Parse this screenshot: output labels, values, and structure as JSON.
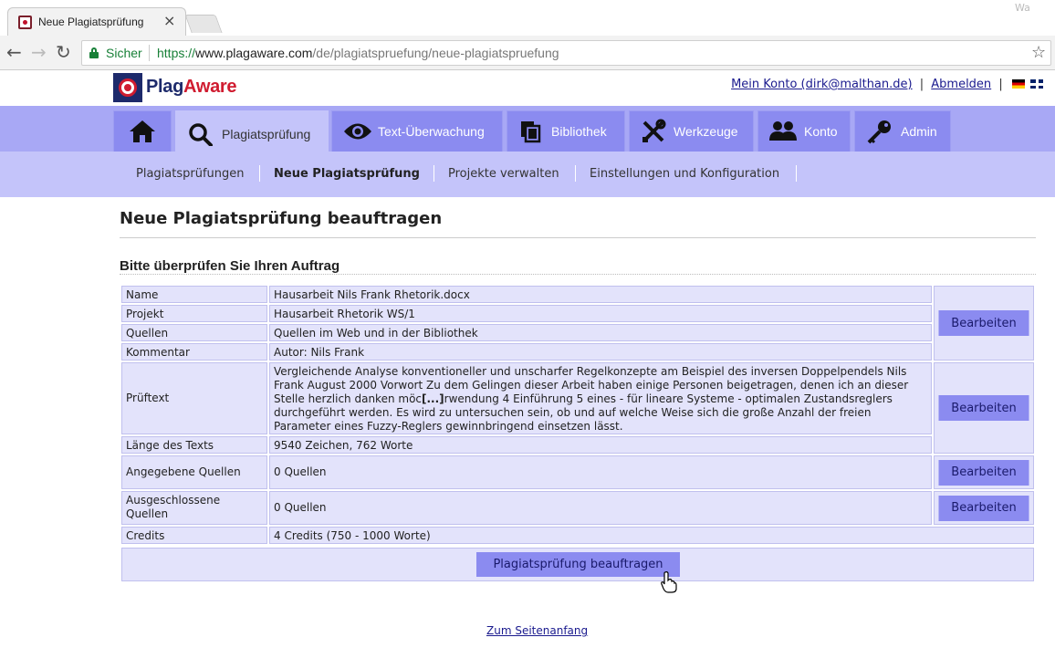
{
  "browser": {
    "tab_title": "Neue Plagiatsprüfung",
    "tab_close": "×",
    "user_label": "Wa",
    "secure_label": "Sicher",
    "url_scheme": "https://",
    "url_host": "www.plagaware.com",
    "url_path": "/de/plagiatspruefung/neue-plagiatspruefung",
    "back_icon": "←",
    "forward_icon": "→",
    "reload_icon": "↻",
    "star_icon": "☆"
  },
  "site": {
    "logo_part1": "Plag",
    "logo_part2": "Aware",
    "account_link": "Mein Konto (dirk@malthan.de)",
    "separator": "|",
    "logout_link": "Abmelden"
  },
  "mainnav": {
    "items": [
      {
        "label": "",
        "icon": "home-icon"
      },
      {
        "label": "Plagiatsprüfung",
        "icon": "search-icon"
      },
      {
        "label": "Text-Überwachung",
        "icon": "eye-icon"
      },
      {
        "label": "Bibliothek",
        "icon": "files-icon"
      },
      {
        "label": "Werkzeuge",
        "icon": "tools-icon"
      },
      {
        "label": "Konto",
        "icon": "users-icon"
      },
      {
        "label": "Admin",
        "icon": "key-icon"
      }
    ]
  },
  "subnav": {
    "items": [
      {
        "label": "Plagiatsprüfungen"
      },
      {
        "label": "Neue Plagiatsprüfung"
      },
      {
        "label": "Projekte verwalten"
      },
      {
        "label": "Einstellungen und Konfiguration"
      }
    ]
  },
  "page": {
    "title": "Neue Plagiatsprüfung beauftragen",
    "section_title": "Bitte überprüfen Sie Ihren Auftrag",
    "edit_label": "Bearbeiten",
    "submit_label": "Plagiatsprüfung beauftragen",
    "top_link": "Zum Seitenanfang"
  },
  "order": {
    "rows": [
      {
        "label": "Name",
        "value": "Hausarbeit Nils Frank Rhetorik.docx"
      },
      {
        "label": "Projekt",
        "value": "Hausarbeit Rhetorik WS/1"
      },
      {
        "label": "Quellen",
        "value": "Quellen im Web und in der Bibliothek"
      },
      {
        "label": "Kommentar",
        "value": "Autor: Nils Frank"
      },
      {
        "label": "Prüftext",
        "value_before": "Vergleichende Analyse konventioneller und unscharfer Regelkonzepte am Beispiel des inversen Doppelpendels Nils Frank August 2000 Vorwort Zu dem Gelingen dieser Arbeit haben einige Personen beigetragen, denen ich an dieser Stelle herzlich danken möc",
        "ellipsis": "[...]",
        "value_after": "rwendung 4 Einführung 5 eines - für lineare Systeme - optimalen Zustandsreglers durchgeführt werden. Es wird zu untersuchen sein, ob und auf welche Weise sich die große Anzahl der freien Parameter eines Fuzzy-Reglers gewinnbringend einsetzen lässt."
      },
      {
        "label": "Länge des Texts",
        "value": "9540 Zeichen, 762 Worte"
      },
      {
        "label": "Angegebene Quellen",
        "value": "0 Quellen"
      },
      {
        "label": "Ausgeschlossene Quellen",
        "value": "0 Quellen"
      },
      {
        "label": "Credits",
        "value": "4 Credits (750 - 1000 Worte)"
      }
    ]
  },
  "colors": {
    "nav_bg": "#a8a8f5",
    "tab_bg": "#8b8bf0",
    "active_bg": "#c4c4fa",
    "cell_bg": "#e3e3fb",
    "logo_blue": "#1d2a6b",
    "logo_red": "#d01c30"
  }
}
